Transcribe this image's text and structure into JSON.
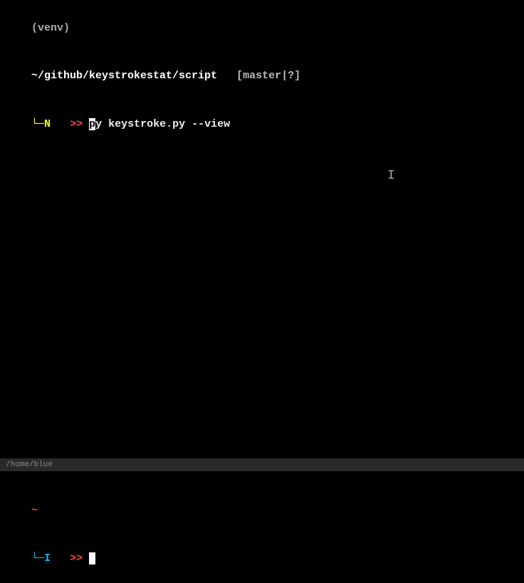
{
  "top_pane": {
    "venv": "(venv)",
    "path": "~/github/keystrokestat/script",
    "git_status": "[master|?]",
    "prompt_corner": "└─",
    "mode": "N",
    "arrows": ">>",
    "cursor_char": "p",
    "command_rest": "y keystroke.py --view"
  },
  "divider": {
    "path": "/home/blue"
  },
  "bottom_pane": {
    "tilde": "~",
    "prompt_corner": "└─",
    "mode": "I",
    "arrows": ">>",
    "cursor_char": " "
  },
  "mouse_cursor": "I"
}
